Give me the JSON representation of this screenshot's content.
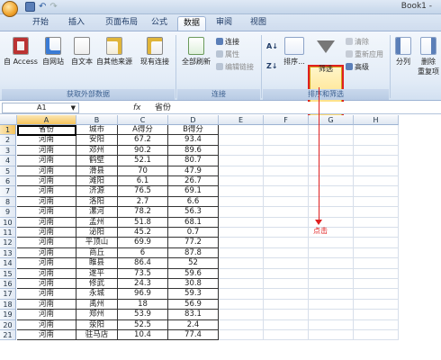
{
  "window": {
    "title": "Book1 -"
  },
  "tabs": [
    {
      "label": "开始",
      "active": false
    },
    {
      "label": "插入",
      "active": false
    },
    {
      "label": "页面布局",
      "active": false
    },
    {
      "label": "公式",
      "active": false
    },
    {
      "label": "数据",
      "active": true
    },
    {
      "label": "审阅",
      "active": false
    },
    {
      "label": "视图",
      "active": false
    }
  ],
  "ribbon": {
    "external": {
      "access": "自 Access",
      "web": "自网站",
      "text": "自文本",
      "other": "自其他来源",
      "existing": "现有连接",
      "group_label": "获取外部数据"
    },
    "connections": {
      "refresh_all": "全部刷新",
      "connections": "连接",
      "properties": "属性",
      "edit_links": "编辑链接",
      "group_label": "连接"
    },
    "sort_filter": {
      "sort": "排序...",
      "filter": "筛选",
      "clear": "清除",
      "reapply": "重新应用",
      "advanced": "高级",
      "group_label": "排序和筛选"
    },
    "tools": {
      "split": "分列",
      "remove": "删除",
      "remove2": "重复项"
    }
  },
  "formula_bar": {
    "name_box": "A1",
    "fx": "fx",
    "value": "省份"
  },
  "columns": [
    "A",
    "B",
    "C",
    "D",
    "E",
    "F",
    "G",
    "H"
  ],
  "table": {
    "headers": [
      "省份",
      "城市",
      "A得分",
      "B得分"
    ],
    "rows": [
      [
        "河南",
        "安阳",
        "67.2",
        "93.4"
      ],
      [
        "河南",
        "邓州",
        "90.2",
        "89.6"
      ],
      [
        "河南",
        "鹤壁",
        "52.1",
        "80.7"
      ],
      [
        "河南",
        "滑县",
        "70",
        "47.9"
      ],
      [
        "河南",
        "滩阳",
        "6.1",
        "26.7"
      ],
      [
        "河南",
        "济源",
        "76.5",
        "69.1"
      ],
      [
        "河南",
        "洛阳",
        "2.7",
        "6.6"
      ],
      [
        "河南",
        "漯河",
        "78.2",
        "56.3"
      ],
      [
        "河南",
        "孟州",
        "51.8",
        "68.1"
      ],
      [
        "河南",
        "泌阳",
        "45.2",
        "0.7"
      ],
      [
        "河南",
        "平顶山",
        "69.9",
        "77.2"
      ],
      [
        "河南",
        "商丘",
        "6",
        "87.8"
      ],
      [
        "河南",
        "睢县",
        "86.4",
        "52"
      ],
      [
        "河南",
        "遂平",
        "73.5",
        "59.6"
      ],
      [
        "河南",
        "修武",
        "24.3",
        "30.8"
      ],
      [
        "河南",
        "永城",
        "96.9",
        "59.3"
      ],
      [
        "河南",
        "禹州",
        "18",
        "56.9"
      ],
      [
        "河南",
        "郑州",
        "53.9",
        "83.1"
      ],
      [
        "河南",
        "荥阳",
        "52.5",
        "2.4"
      ],
      [
        "河南",
        "驻马店",
        "10.4",
        "77.4"
      ]
    ]
  },
  "annotation": {
    "click_label": "点击"
  },
  "colors": {
    "accent": "#e02020",
    "ribbon": "#dfe9f5"
  }
}
